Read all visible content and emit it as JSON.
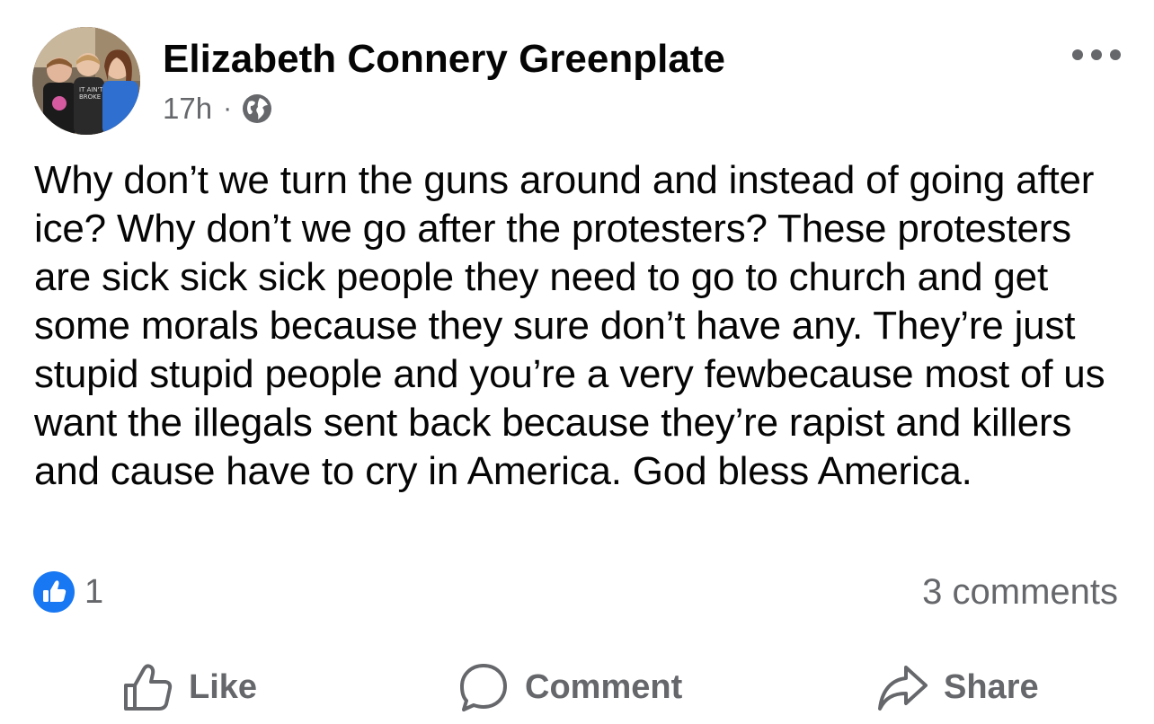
{
  "post": {
    "author_name": "Elizabeth Connery Greenplate",
    "timestamp": "17h",
    "separator": "·",
    "privacy_icon": "globe-icon",
    "body": "Why don’t we turn the guns around and instead of going after ice? Why don’t we go after the protesters? These protesters are sick sick sick people they need to go to church and get some morals because they sure don’t have any. They’re just stupid stupid people and you’re a very fewbecause most of us want the illegals sent back because they’re rapist and killers and cause have to cry in America. God bless America."
  },
  "reactions": {
    "icon": "like-icon",
    "count": "1",
    "comments_label": "3 comments"
  },
  "actions": {
    "like_label": "Like",
    "comment_label": "Comment",
    "share_label": "Share"
  },
  "colors": {
    "text_primary": "#050505",
    "text_secondary": "#65676b",
    "like_blue": "#1877f2"
  }
}
